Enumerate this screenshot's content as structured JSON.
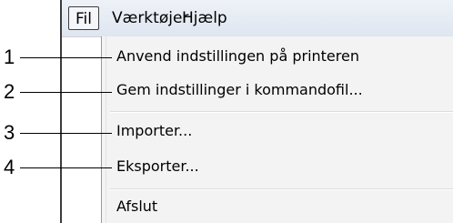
{
  "menubar": {
    "items": [
      {
        "label": "Fil"
      },
      {
        "label": "Værktøjer"
      },
      {
        "label": "Hjælp"
      }
    ]
  },
  "file_menu": {
    "items": [
      {
        "label": "Anvend indstillingen på printeren"
      },
      {
        "label": "Gem indstillinger i kommandofil..."
      },
      {
        "label": "Importer..."
      },
      {
        "label": "Eksporter..."
      },
      {
        "label": "Afslut"
      }
    ]
  },
  "callouts": [
    "1",
    "2",
    "3",
    "4"
  ]
}
